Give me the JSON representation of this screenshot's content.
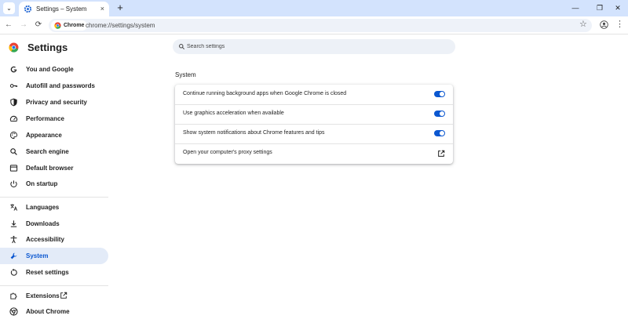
{
  "window": {
    "tab_title": "Settings – System",
    "tab_close_glyph": "×",
    "new_tab_glyph": "+",
    "tab_search_glyph": "⌄",
    "minimize_glyph": "—",
    "maximize_glyph": "❐",
    "close_glyph": "✕"
  },
  "toolbar": {
    "back_glyph": "←",
    "forward_glyph": "→",
    "reload_glyph": "⟳",
    "site_chip": "Chrome",
    "url": "chrome://settings/system",
    "bookmark_glyph": "☆",
    "menu_glyph": "⋮"
  },
  "settings": {
    "title": "Settings",
    "nav": [
      {
        "label": "You and Google",
        "icon": "google-g-icon"
      },
      {
        "label": "Autofill and passwords",
        "icon": "key-icon"
      },
      {
        "label": "Privacy and security",
        "icon": "shield-icon"
      },
      {
        "label": "Performance",
        "icon": "speedometer-icon"
      },
      {
        "label": "Appearance",
        "icon": "palette-icon"
      },
      {
        "label": "Search engine",
        "icon": "search-icon"
      },
      {
        "label": "Default browser",
        "icon": "browser-window-icon"
      },
      {
        "label": "On startup",
        "icon": "power-icon"
      },
      {
        "label": "Languages",
        "icon": "translate-icon"
      },
      {
        "label": "Downloads",
        "icon": "download-icon"
      },
      {
        "label": "Accessibility",
        "icon": "accessibility-icon"
      },
      {
        "label": "System",
        "icon": "wrench-icon",
        "selected": true
      },
      {
        "label": "Reset settings",
        "icon": "reset-icon"
      },
      {
        "label": "Extensions",
        "icon": "puzzle-icon"
      },
      {
        "label": "About Chrome",
        "icon": "chrome-logo-icon"
      }
    ]
  },
  "search": {
    "placeholder": "Search settings"
  },
  "system": {
    "section_title": "System",
    "rows": [
      {
        "label": "Continue running background apps when Google Chrome is closed",
        "enabled": true
      },
      {
        "label": "Use graphics acceleration when available",
        "enabled": true
      },
      {
        "label": "Show system notifications about Chrome features and tips",
        "enabled": true
      },
      {
        "label": "Open your computer's proxy settings"
      }
    ]
  },
  "colors": {
    "accent": "#0b57d0",
    "tabstrip": "#d3e3fd",
    "selected_nav": "#e3ebf8",
    "omnibox": "#eef2f9"
  }
}
